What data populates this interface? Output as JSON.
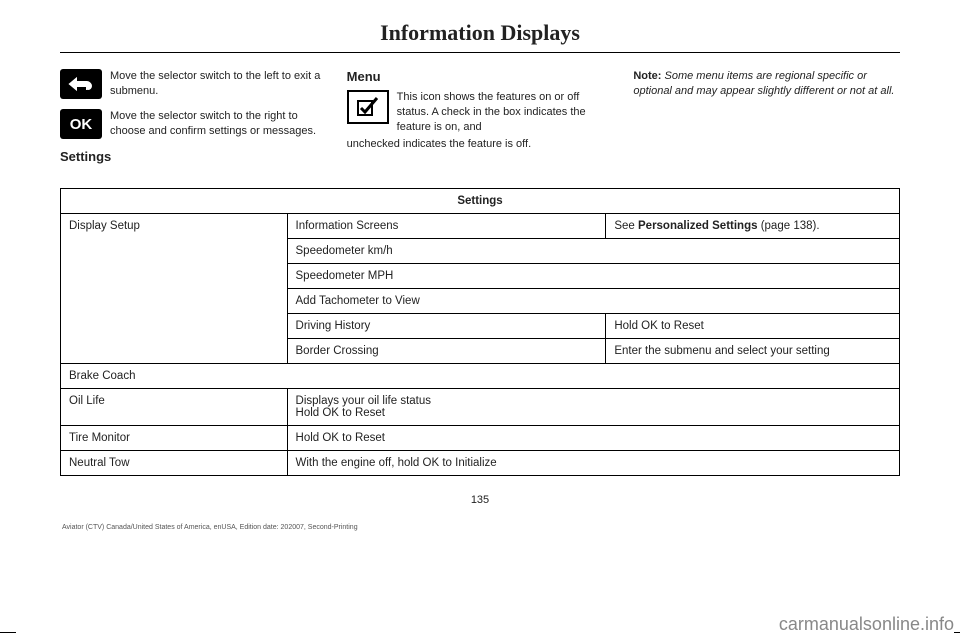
{
  "title": "Information Displays",
  "col1": {
    "item1": {
      "desc": "Move the selector switch to the left to exit a submenu."
    },
    "item2": {
      "icon_text": "OK",
      "desc": "Move the selector switch to the right to choose and confirm settings or messages."
    },
    "settings_heading": "Settings"
  },
  "col2": {
    "heading": "Menu",
    "desc_line1": "This icon shows the features on or off status. A check in the box indicates the feature is on, and",
    "desc_line2": "unchecked indicates the feature is off."
  },
  "col3": {
    "note_label": "Note:",
    "note": " Some menu items are regional specific or optional and may appear slightly different or not at all."
  },
  "table": {
    "header": "Settings",
    "r1c1": "Display Setup",
    "r1c2": "Information Screens",
    "r1c3a": "See ",
    "r1c3b": "Personalized Settings",
    "r1c3c": " (page 138).",
    "r2c2": "Speedometer km/h",
    "r3c2": "Speedometer MPH",
    "r4c2": "Add Tachometer to View",
    "r5c2": "Driving History",
    "r5c3": "Hold OK to Reset",
    "r6c2": "Border Crossing",
    "r6c3": "Enter the submenu and select your setting",
    "r7c1": "Brake Coach",
    "r8c1": "Oil Life",
    "r8c2a": "Displays your oil life status",
    "r8c2b": "Hold OK to Reset",
    "r9c1": "Tire Monitor",
    "r9c2": "Hold OK to Reset",
    "r10c1": "Neutral Tow",
    "r10c2": "With the engine off, hold OK to Initialize"
  },
  "page_num": "135",
  "footer": "Aviator (CTV) Canada/United States of America, enUSA, Edition date: 202007, Second-Printing",
  "watermark": "carmanualsonline.info"
}
